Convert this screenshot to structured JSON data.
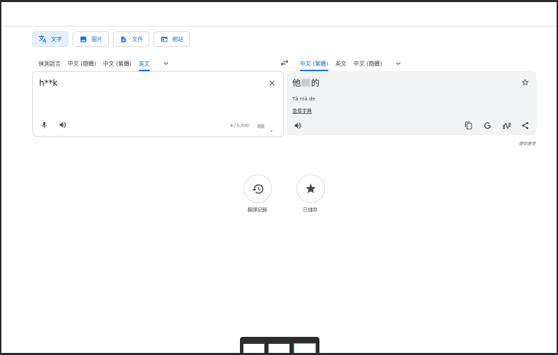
{
  "modes": [
    {
      "label": "文字",
      "icon": "translate-icon",
      "active": true
    },
    {
      "label": "圖片",
      "icon": "image-icon",
      "active": false
    },
    {
      "label": "文件",
      "icon": "document-icon",
      "active": false
    },
    {
      "label": "網站",
      "icon": "website-icon",
      "active": false
    }
  ],
  "source_langs": [
    "偵測語言",
    "中文 (簡體)",
    "中文 (繁體)",
    "英文"
  ],
  "target_langs": [
    "中文 (繁體)",
    "英文",
    "中文 (簡體)"
  ],
  "source": {
    "text": "h**k",
    "counter": "4 / 5,000"
  },
  "target": {
    "text_before": "他",
    "text_after": "的",
    "romanization": "Tā mā de",
    "dict_link": "查看字典"
  },
  "feedback": "提供意見",
  "history": {
    "label": "翻譯記錄",
    "icon": "history-icon"
  },
  "saved": {
    "label": "已儲存",
    "icon": "star-icon"
  },
  "colors": {
    "accent": "#1a73e8",
    "panel": "#f1f3f4"
  }
}
